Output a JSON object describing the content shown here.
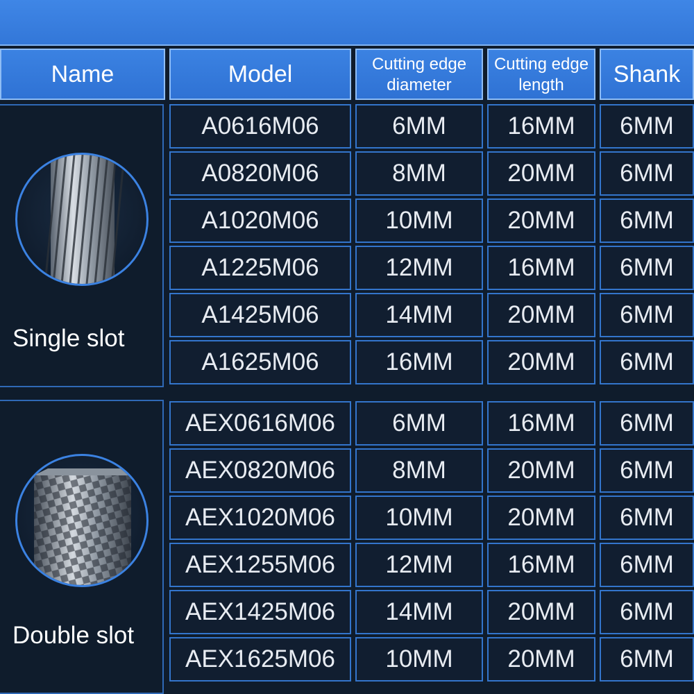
{
  "header": {
    "name": "Name",
    "model": "Model",
    "diameter_line1": "Cutting edge",
    "diameter_line2": "diameter",
    "length_line1": "Cutting edge",
    "length_line2": "length",
    "shank": "Shank"
  },
  "groups": [
    {
      "name": "Single slot",
      "image": "single-slot-burr-image",
      "rows": [
        {
          "model": "A0616M06",
          "diameter": "6MM",
          "length": "16MM",
          "shank": "6MM"
        },
        {
          "model": "A0820M06",
          "diameter": "8MM",
          "length": "20MM",
          "shank": "6MM"
        },
        {
          "model": "A1020M06",
          "diameter": "10MM",
          "length": "20MM",
          "shank": "6MM"
        },
        {
          "model": "A1225M06",
          "diameter": "12MM",
          "length": "16MM",
          "shank": "6MM"
        },
        {
          "model": "A1425M06",
          "diameter": "14MM",
          "length": "20MM",
          "shank": "6MM"
        },
        {
          "model": "A1625M06",
          "diameter": "16MM",
          "length": "20MM",
          "shank": "6MM"
        }
      ]
    },
    {
      "name": "Double slot",
      "image": "double-slot-burr-image",
      "rows": [
        {
          "model": "AEX0616M06",
          "diameter": "6MM",
          "length": "16MM",
          "shank": "6MM"
        },
        {
          "model": "AEX0820M06",
          "diameter": "8MM",
          "length": "20MM",
          "shank": "6MM"
        },
        {
          "model": "AEX1020M06",
          "diameter": "10MM",
          "length": "20MM",
          "shank": "6MM"
        },
        {
          "model": "AEX1255M06",
          "diameter": "12MM",
          "length": "16MM",
          "shank": "6MM"
        },
        {
          "model": "AEX1425M06",
          "diameter": "14MM",
          "length": "20MM",
          "shank": "6MM"
        },
        {
          "model": "AEX1625M06",
          "diameter": "10MM",
          "length": "20MM",
          "shank": "6MM"
        }
      ]
    }
  ],
  "colors": {
    "background": "#0f1c2c",
    "header_blue": "#3377d8",
    "cell_border": "#3375cc"
  }
}
